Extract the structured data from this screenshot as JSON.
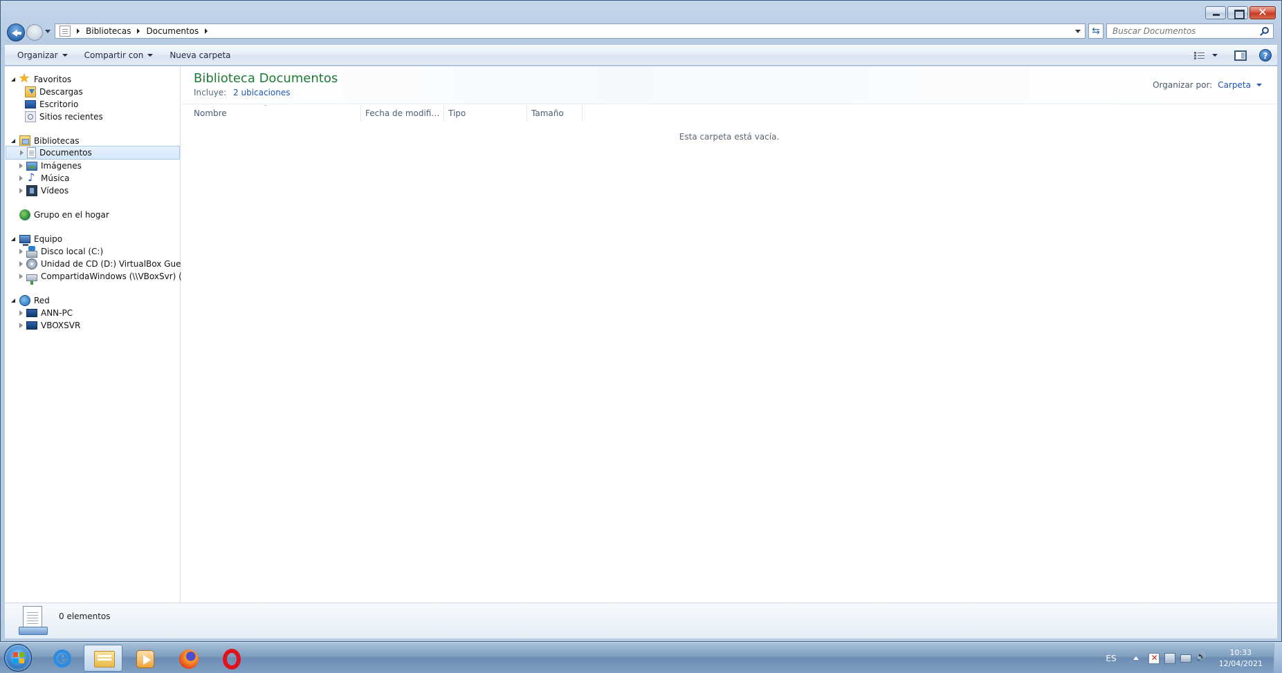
{
  "window": {
    "controls": {
      "minimize": "minimize",
      "maximize": "maximize",
      "close": "✕"
    }
  },
  "address": {
    "crumbs": [
      "Bibliotecas",
      "Documentos"
    ],
    "search_placeholder": "Buscar Documentos"
  },
  "toolbar": {
    "organize": "Organizar",
    "share": "Compartir con",
    "new_folder": "Nueva carpeta",
    "help": "?"
  },
  "navpane": {
    "favorites": {
      "label": "Favoritos",
      "items": [
        "Descargas",
        "Escritorio",
        "Sitios recientes"
      ]
    },
    "libraries": {
      "label": "Bibliotecas",
      "items": [
        "Documentos",
        "Imágenes",
        "Música",
        "Vídeos"
      ]
    },
    "homegroup": "Grupo en el hogar",
    "computer": {
      "label": "Equipo",
      "items": [
        "Disco local (C:)",
        "Unidad de CD (D:) VirtualBox Guest Ad",
        "CompartidaWindows (\\\\VBoxSvr) (Z:)"
      ]
    },
    "network": {
      "label": "Red",
      "items": [
        "ANN-PC",
        "VBOXSVR"
      ]
    }
  },
  "main": {
    "title": "Biblioteca Documentos",
    "includes_label": "Incluye:",
    "includes_link": "2 ubicaciones",
    "arrange_label": "Organizar por:",
    "arrange_value": "Carpeta",
    "columns": [
      "Nombre",
      "Fecha de modifica...",
      "Tipo",
      "Tamaño"
    ],
    "empty_message": "Esta carpeta está vacía."
  },
  "details": {
    "count": "0 elementos"
  },
  "taskbar": {
    "apps": [
      "internet-explorer",
      "windows-explorer",
      "media-player",
      "firefox",
      "opera"
    ],
    "language": "ES",
    "time": "10:33",
    "date": "12/04/2021"
  }
}
